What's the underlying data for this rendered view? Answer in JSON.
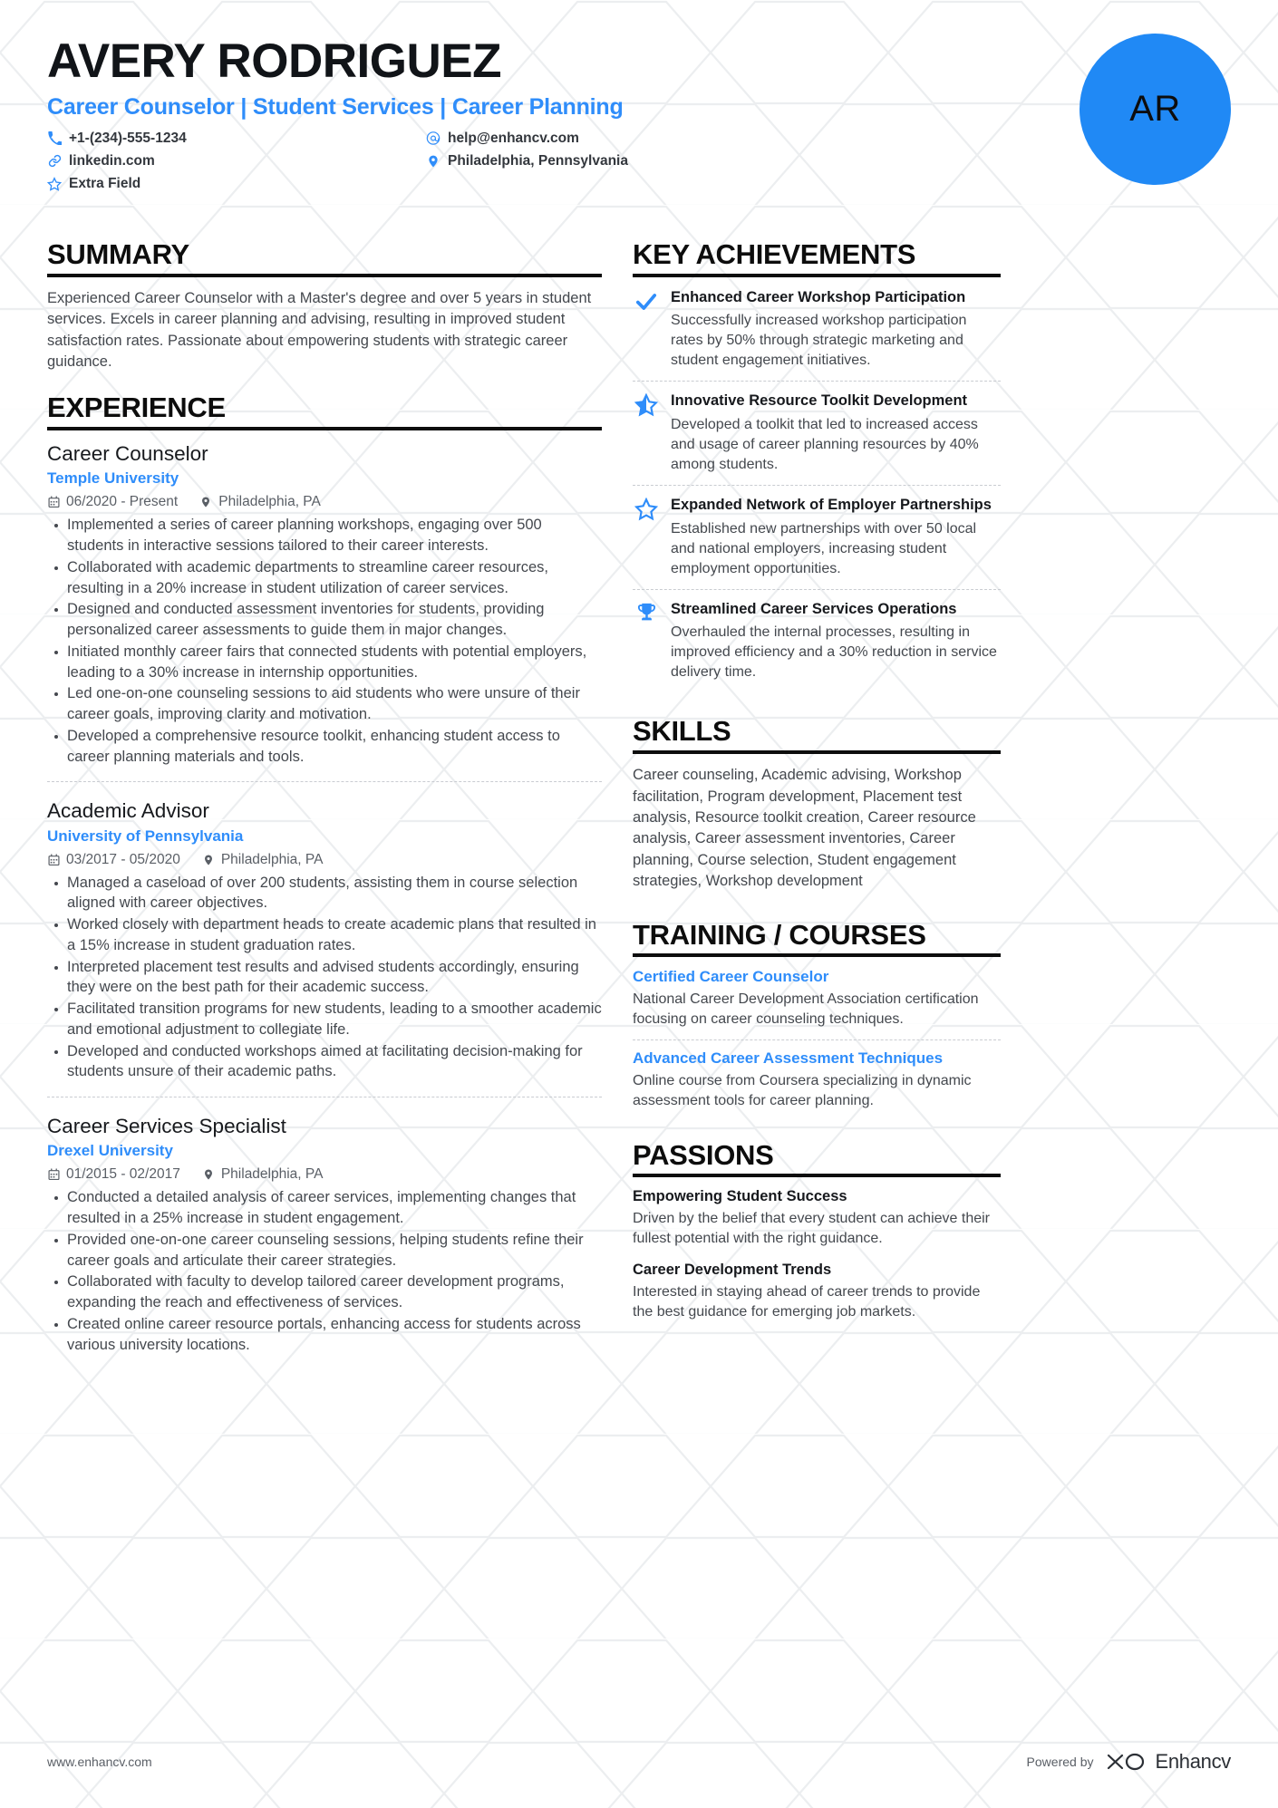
{
  "header": {
    "name": "AVERY RODRIGUEZ",
    "headline": "Career Counselor | Student Services | Career Planning",
    "avatar_initials": "AR",
    "accent_color": "#2f8dfa",
    "avatar_color": "#2089f5",
    "contacts_left": [
      {
        "icon": "phone-icon",
        "text": "+1-(234)-555-1234"
      },
      {
        "icon": "link-icon",
        "text": "linkedin.com"
      },
      {
        "icon": "star-icon",
        "text": "Extra Field"
      }
    ],
    "contacts_right": [
      {
        "icon": "email-icon",
        "text": "help@enhancv.com"
      },
      {
        "icon": "location-pin-icon",
        "text": "Philadelphia, Pennsylvania"
      }
    ]
  },
  "summary": {
    "title": "SUMMARY",
    "text": "Experienced Career Counselor with a Master's degree and over 5 years in student services. Excels in career planning and advising, resulting in improved student satisfaction rates. Passionate about empowering students with strategic career guidance."
  },
  "experience": {
    "title": "EXPERIENCE",
    "jobs": [
      {
        "title": "Career Counselor",
        "company": "Temple University",
        "dates": "06/2020 - Present",
        "location": "Philadelphia, PA",
        "bullets": [
          "Implemented a series of career planning workshops, engaging over 500 students in interactive sessions tailored to their career interests.",
          "Collaborated with academic departments to streamline career resources, resulting in a 20% increase in student utilization of career services.",
          "Designed and conducted assessment inventories for students, providing personalized career assessments to guide them in major changes.",
          "Initiated monthly career fairs that connected students with potential employers, leading to a 30% increase in internship opportunities.",
          "Led one-on-one counseling sessions to aid students who were unsure of their career goals, improving clarity and motivation.",
          "Developed a comprehensive resource toolkit, enhancing student access to career planning materials and tools."
        ]
      },
      {
        "title": "Academic Advisor",
        "company": "University of Pennsylvania",
        "dates": "03/2017 - 05/2020",
        "location": "Philadelphia, PA",
        "bullets": [
          "Managed a caseload of over 200 students, assisting them in course selection aligned with career objectives.",
          "Worked closely with department heads to create academic plans that resulted in a 15% increase in student graduation rates.",
          "Interpreted placement test results and advised students accordingly, ensuring they were on the best path for their academic success.",
          "Facilitated transition programs for new students, leading to a smoother academic and emotional adjustment to collegiate life.",
          "Developed and conducted workshops aimed at facilitating decision-making for students unsure of their academic paths."
        ]
      },
      {
        "title": "Career Services Specialist",
        "company": "Drexel University",
        "dates": "01/2015 - 02/2017",
        "location": "Philadelphia, PA",
        "bullets": [
          "Conducted a detailed analysis of career services, implementing changes that resulted in a 25% increase in student engagement.",
          "Provided one-on-one career counseling sessions, helping students refine their career goals and articulate their career strategies.",
          "Collaborated with faculty to develop tailored career development programs, expanding the reach and effectiveness of services.",
          "Created online career resource portals, enhancing access for students across various university locations."
        ]
      }
    ]
  },
  "key_achievements": {
    "title": "KEY ACHIEVEMENTS",
    "items": [
      {
        "icon": "check-icon",
        "title": "Enhanced Career Workshop Participation",
        "desc": "Successfully increased workshop participation rates by 50% through strategic marketing and student engagement initiatives."
      },
      {
        "icon": "star-half-icon",
        "title": "Innovative Resource Toolkit Development",
        "desc": "Developed a toolkit that led to increased access and usage of career planning resources by 40% among students."
      },
      {
        "icon": "star-outline-icon",
        "title": "Expanded Network of Employer Partnerships",
        "desc": "Established new partnerships with over 50 local and national employers, increasing student employment opportunities."
      },
      {
        "icon": "trophy-icon",
        "title": "Streamlined Career Services Operations",
        "desc": "Overhauled the internal processes, resulting in improved efficiency and a 30% reduction in service delivery time."
      }
    ]
  },
  "skills": {
    "title": "SKILLS",
    "text": "Career counseling, Academic advising, Workshop facilitation, Program development, Placement test analysis, Resource toolkit creation, Career resource analysis, Career assessment inventories, Career planning, Course selection, Student engagement strategies, Workshop development"
  },
  "training": {
    "title": "TRAINING / COURSES",
    "items": [
      {
        "title": "Certified Career Counselor",
        "desc": "National Career Development Association certification focusing on career counseling techniques."
      },
      {
        "title": "Advanced Career Assessment Techniques",
        "desc": "Online course from Coursera specializing in dynamic assessment tools for career planning."
      }
    ]
  },
  "passions": {
    "title": "PASSIONS",
    "items": [
      {
        "title": "Empowering Student Success",
        "desc": "Driven by the belief that every student can achieve their fullest potential with the right guidance."
      },
      {
        "title": "Career Development Trends",
        "desc": "Interested in staying ahead of career trends to provide the best guidance for emerging job markets."
      }
    ]
  },
  "footer": {
    "url": "www.enhancv.com",
    "powered_by": "Powered by",
    "brand": "Enhancv"
  }
}
